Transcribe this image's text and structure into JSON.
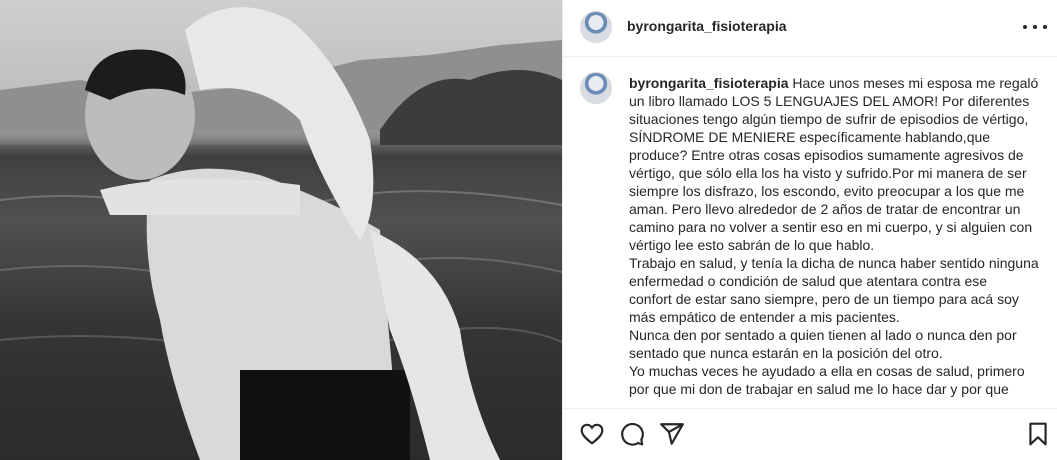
{
  "post": {
    "username": "byrongarita_fisioterapia",
    "caption_username": "byrongarita_fisioterapia",
    "caption_text": "Hace unos meses mi esposa me regaló\nun libro llamado LOS 5 LENGUAJES DEL AMOR! Por diferentes\nsituaciones tengo algún tiempo de sufrir de episodios de vértigo,\nSÍNDROME DE MENIERE específicamente hablando,que\nproduce? Entre otras cosas episodios sumamente agresivos de\nvértigo, que sólo ella los ha visto y sufrido.Por mi manera de ser\nsiempre los disfrazo, los escondo, evito preocupar a los que me\naman. Pero llevo alrededor de 2 años de tratar de encontrar un\ncamino para no volver a sentir eso en mi cuerpo, y si alguien con\nvértigo lee esto sabrán de lo que hablo.\nTrabajo en salud, y tenía la dicha de nunca haber sentido ninguna\nenfermedad o condición de salud que atentara contra ese\nconfort de estar sano siempre, pero de un tiempo para acá soy\nmás empático de entender a mis pacientes.\nNunca den por sentado a quien tienen al lado o nunca den por\nsentado que nunca estarán en la posición del otro.\nYo muchas veces he ayudado a ella en cosas de salud, primero\npor que mi don de trabajar en salud me lo hace dar y por que"
  },
  "icons": {
    "more": "more-options-icon",
    "like": "heart-icon",
    "comment": "comment-icon",
    "share": "share-icon",
    "save": "bookmark-icon"
  },
  "colors": {
    "text": "#262626",
    "border": "#efefef"
  }
}
